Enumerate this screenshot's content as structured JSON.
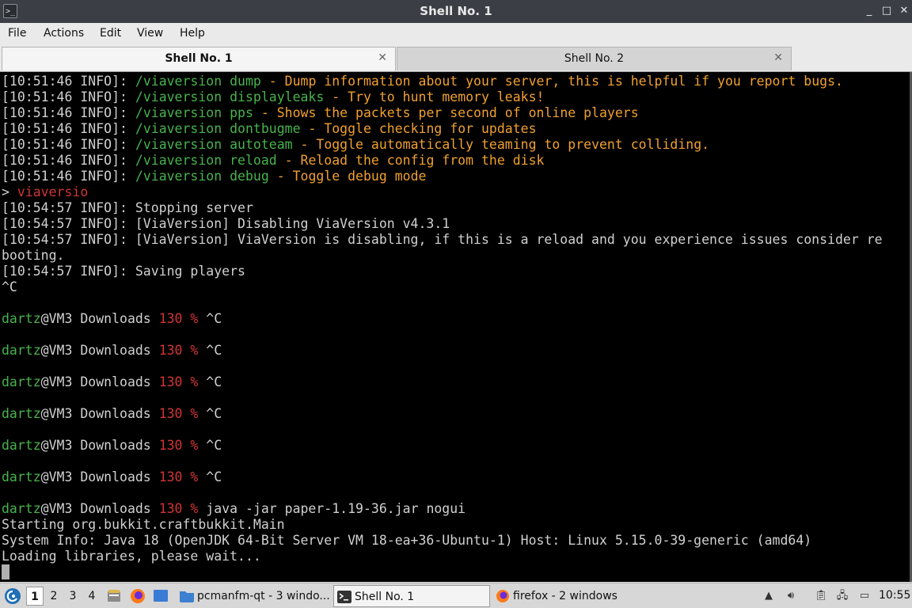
{
  "window": {
    "title": "Shell No. 1",
    "controls": {
      "minimize": "_",
      "maximize": "□",
      "close": "✕"
    }
  },
  "menu": [
    "File",
    "Actions",
    "Edit",
    "View",
    "Help"
  ],
  "tabs": [
    {
      "label": "Shell No. 1",
      "close": "✕",
      "active": true
    },
    {
      "label": "Shell No. 2",
      "close": "✕",
      "active": false
    }
  ],
  "terminal": {
    "colors": {
      "background": "#000000",
      "text": "#d0d0d0",
      "green": "#47b34d",
      "orange": "#f0a030",
      "red": "#d13535"
    },
    "lines": [
      {
        "segments": [
          {
            "t": "[10:51:46 INFO]: ",
            "c": "w"
          },
          {
            "t": "/viaversion dump",
            "c": "g"
          },
          {
            "t": " - Dump information about your server, this is helpful if you report bugs.",
            "c": "o"
          }
        ]
      },
      {
        "segments": [
          {
            "t": "[10:51:46 INFO]: ",
            "c": "w"
          },
          {
            "t": "/viaversion displayleaks",
            "c": "g"
          },
          {
            "t": " - Try to hunt memory leaks!",
            "c": "o"
          }
        ]
      },
      {
        "segments": [
          {
            "t": "[10:51:46 INFO]: ",
            "c": "w"
          },
          {
            "t": "/viaversion pps",
            "c": "g"
          },
          {
            "t": " - Shows the packets per second of online players",
            "c": "o"
          }
        ]
      },
      {
        "segments": [
          {
            "t": "[10:51:46 INFO]: ",
            "c": "w"
          },
          {
            "t": "/viaversion dontbugme",
            "c": "g"
          },
          {
            "t": " - Toggle checking for updates",
            "c": "o"
          }
        ]
      },
      {
        "segments": [
          {
            "t": "[10:51:46 INFO]: ",
            "c": "w"
          },
          {
            "t": "/viaversion autoteam",
            "c": "g"
          },
          {
            "t": " - Toggle automatically teaming to prevent colliding.",
            "c": "o"
          }
        ]
      },
      {
        "segments": [
          {
            "t": "[10:51:46 INFO]: ",
            "c": "w"
          },
          {
            "t": "/viaversion reload",
            "c": "g"
          },
          {
            "t": " - Reload the config from the disk",
            "c": "o"
          }
        ]
      },
      {
        "segments": [
          {
            "t": "[10:51:46 INFO]: ",
            "c": "w"
          },
          {
            "t": "/viaversion debug",
            "c": "g"
          },
          {
            "t": " - Toggle debug mode",
            "c": "o"
          }
        ]
      },
      {
        "segments": [
          {
            "t": "> ",
            "c": "w"
          },
          {
            "t": "viaversio",
            "c": "r"
          }
        ]
      },
      {
        "segments": [
          {
            "t": "[10:54:57 INFO]: Stopping server",
            "c": "w"
          }
        ]
      },
      {
        "segments": [
          {
            "t": "[10:54:57 INFO]: [ViaVersion] Disabling ViaVersion v4.3.1",
            "c": "w"
          }
        ]
      },
      {
        "segments": [
          {
            "t": "[10:54:57 INFO]: [ViaVersion] ViaVersion is disabling, if this is a reload and you experience issues consider re",
            "c": "w"
          }
        ]
      },
      {
        "segments": [
          {
            "t": "booting.",
            "c": "w"
          }
        ]
      },
      {
        "segments": [
          {
            "t": "[10:54:57 INFO]: Saving players",
            "c": "w"
          }
        ]
      },
      {
        "segments": [
          {
            "t": "^C",
            "c": "w"
          }
        ]
      },
      {
        "segments": []
      },
      {
        "segments": [
          {
            "t": "dartz",
            "c": "g"
          },
          {
            "t": "@VM3 Downloads ",
            "c": "w"
          },
          {
            "t": "130 % ",
            "c": "r"
          },
          {
            "t": "^C",
            "c": "w"
          }
        ]
      },
      {
        "segments": []
      },
      {
        "segments": [
          {
            "t": "dartz",
            "c": "g"
          },
          {
            "t": "@VM3 Downloads ",
            "c": "w"
          },
          {
            "t": "130 % ",
            "c": "r"
          },
          {
            "t": "^C",
            "c": "w"
          }
        ]
      },
      {
        "segments": []
      },
      {
        "segments": [
          {
            "t": "dartz",
            "c": "g"
          },
          {
            "t": "@VM3 Downloads ",
            "c": "w"
          },
          {
            "t": "130 % ",
            "c": "r"
          },
          {
            "t": "^C",
            "c": "w"
          }
        ]
      },
      {
        "segments": []
      },
      {
        "segments": [
          {
            "t": "dartz",
            "c": "g"
          },
          {
            "t": "@VM3 Downloads ",
            "c": "w"
          },
          {
            "t": "130 % ",
            "c": "r"
          },
          {
            "t": "^C",
            "c": "w"
          }
        ]
      },
      {
        "segments": []
      },
      {
        "segments": [
          {
            "t": "dartz",
            "c": "g"
          },
          {
            "t": "@VM3 Downloads ",
            "c": "w"
          },
          {
            "t": "130 % ",
            "c": "r"
          },
          {
            "t": "^C",
            "c": "w"
          }
        ]
      },
      {
        "segments": []
      },
      {
        "segments": [
          {
            "t": "dartz",
            "c": "g"
          },
          {
            "t": "@VM3 Downloads ",
            "c": "w"
          },
          {
            "t": "130 % ",
            "c": "r"
          },
          {
            "t": "^C",
            "c": "w"
          }
        ]
      },
      {
        "segments": []
      },
      {
        "segments": [
          {
            "t": "dartz",
            "c": "g"
          },
          {
            "t": "@VM3 Downloads ",
            "c": "w"
          },
          {
            "t": "130 % ",
            "c": "r"
          },
          {
            "t": "java -jar paper-1.19-36.jar nogui",
            "c": "w"
          }
        ]
      },
      {
        "segments": [
          {
            "t": "Starting org.bukkit.craftbukkit.Main",
            "c": "w"
          }
        ]
      },
      {
        "segments": [
          {
            "t": "System Info: Java 18 (OpenJDK 64-Bit Server VM 18-ea+36-Ubuntu-1) Host: Linux 5.15.0-39-generic (amd64)",
            "c": "w"
          }
        ]
      },
      {
        "segments": [
          {
            "t": "Loading libraries, please wait...",
            "c": "w"
          }
        ]
      }
    ]
  },
  "taskbar": {
    "start_icon": "debian-swirl-icon",
    "workspaces": [
      "1",
      "2",
      "3",
      "4"
    ],
    "active_workspace": "1",
    "tasks": [
      {
        "label": "pcmanfm-qt - 3 windo...",
        "icon": "folder-icon",
        "active": false
      },
      {
        "label": "Shell No. 1",
        "icon": "terminal-icon",
        "active": true
      },
      {
        "label": "firefox - 2 windows",
        "icon": "firefox-icon",
        "active": false
      }
    ],
    "clock": "10:55"
  }
}
